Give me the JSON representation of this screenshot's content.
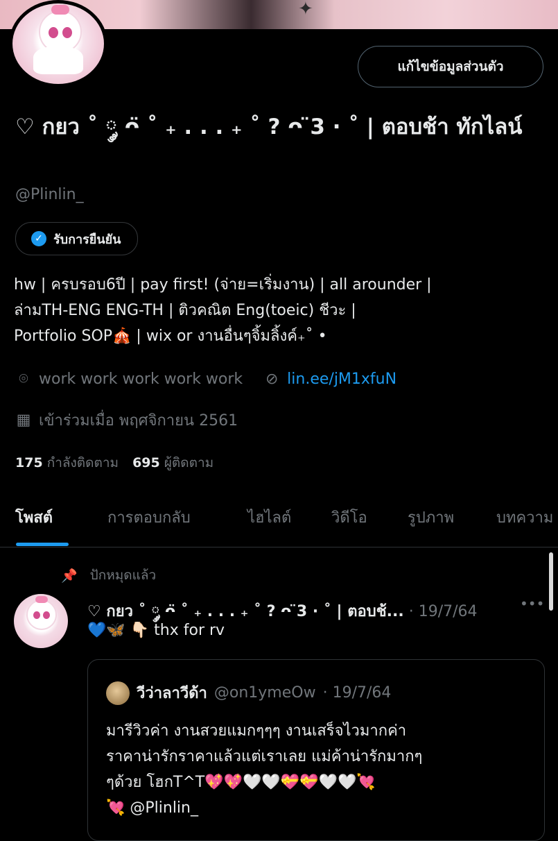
{
  "profile": {
    "edit_button": "แก้ไขข้อมูลส่วนตัว",
    "name": "♡ กยว ˚ ༘ ᴖ̈ ˚ ₊ . . . ₊ ˚ ? ᴖ ̈3 ⋅ ˚ | ตอบช้า ทักไลน์",
    "handle": "@Plinlin_",
    "verified_label": "รับการยืนยัน",
    "bio_lines": [
      "hw | ครบรอบ6ปี | pay first! (จ่าย=เริ่มงาน) | all arounder |",
      "ล่ามTH-ENG ENG-TH | ติวคณิต Eng(toeic) ชีวะ |",
      "Portfolio SOP🎪 | wix or งานอื่นๆจิ้มลิ้งค์₊˚ •"
    ],
    "location": "work work work work work",
    "link": "lin.ee/jM1xfuN",
    "joined": "เข้าร่วมเมื่อ พฤศจิกายน 2561",
    "following_count": "175",
    "following_label": "กำลังติดตาม",
    "followers_count": "695",
    "followers_label": "ผู้ติดตาม"
  },
  "tabs": [
    {
      "label": "โพสต์",
      "active": true
    },
    {
      "label": "การตอบกลับ",
      "active": false
    },
    {
      "label": "ไฮไลต์",
      "active": false
    },
    {
      "label": "วิดีโอ",
      "active": false
    },
    {
      "label": "รูปภาพ",
      "active": false
    },
    {
      "label": "บทความ",
      "active": false
    }
  ],
  "post": {
    "pinned_label": "ปักหมุดแล้ว",
    "author": "♡ กยว ˚ ༘ ᴖ̈ ˚ ₊ . . . ₊ ˚ ? ᴖ ̈3 ⋅ ˚ | ตอบช้...",
    "time": "· 19/7/64",
    "more": "•••",
    "text": "💙🦋 👇🏻 thx for rv",
    "quote": {
      "author": "วีว่าลาวีด้า",
      "handle": "@on1ymeOw",
      "time": "· 19/7/64",
      "lines": [
        "มารีวิวค่า งานสวยแมกๆๆๆ งานเสร็จไวมากค่า",
        "ราคาน่ารักราคาแล้วแต่เราเลย แม่ค้าน่ารักมากๆ",
        "ๆด้วย โฮกT^T💖💖🤍🤍💝💝🤍🤍💘",
        "💘 @Plinlin_"
      ]
    }
  },
  "icons": {
    "location": "location-pin-icon",
    "link": "link-icon",
    "calendar": "calendar-icon",
    "pin": "pin-icon",
    "verified": "verified-badge-icon"
  },
  "colors": {
    "accent": "#1d9bf0",
    "background": "#000000",
    "muted_text": "#71767b"
  }
}
